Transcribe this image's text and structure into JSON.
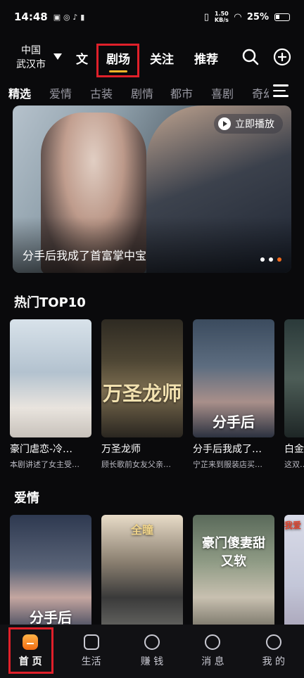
{
  "status_bar": {
    "time": "14:48",
    "speed_value": "1.50",
    "speed_unit": "KB/s",
    "battery": "25%"
  },
  "top_nav": {
    "location_line1": "中国",
    "location_line2": "武汉市",
    "tabs": [
      {
        "label": "文"
      },
      {
        "label": "剧场"
      },
      {
        "label": "关注"
      },
      {
        "label": "推荐"
      }
    ]
  },
  "categories": [
    "精选",
    "爱情",
    "古装",
    "剧情",
    "都市",
    "喜剧",
    "奇幻"
  ],
  "banner": {
    "play_label": "立即播放",
    "title": "分手后我成了首富掌中宝"
  },
  "sections": [
    {
      "title": "热门TOP10",
      "cards": [
        {
          "title": "豪门虐恋-冷…",
          "subtitle": "本剧讲述了女主受…"
        },
        {
          "title": "万圣龙师",
          "subtitle": "顾长歌前女友父亲…",
          "poster_text": "万圣龙师"
        },
        {
          "title": "分手后我成了…",
          "subtitle": "宁芷来到服装店买…",
          "poster_text": "分手后"
        },
        {
          "title": "白金…",
          "subtitle": "这双…"
        }
      ]
    },
    {
      "title": "爱情",
      "cards": [
        {
          "poster_text": "分手后"
        },
        {
          "poster_text": "全瞳"
        },
        {
          "poster_text": "豪门傻妻甜又软"
        },
        {
          "poster_text": "我爱"
        }
      ]
    }
  ],
  "tab_bar": [
    {
      "label": "首 页"
    },
    {
      "label": "生活"
    },
    {
      "label": "赚 钱"
    },
    {
      "label": "消 息"
    },
    {
      "label": "我 的"
    }
  ]
}
